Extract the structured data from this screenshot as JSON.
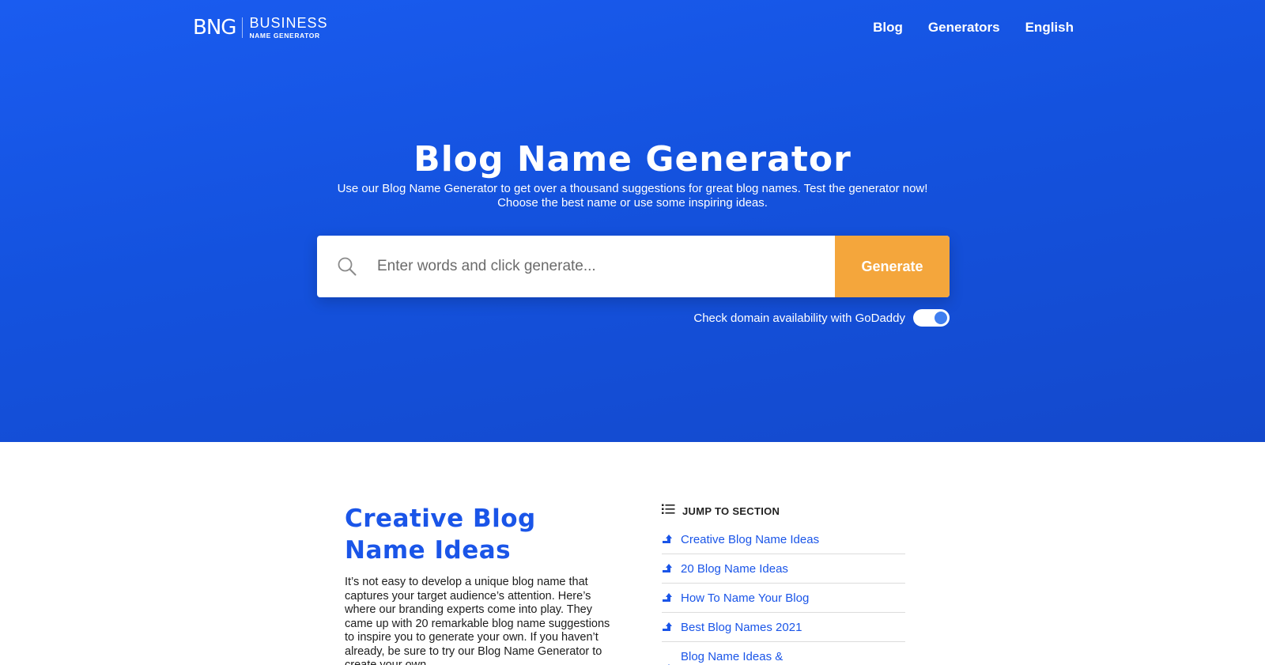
{
  "header": {
    "logo_mark": "BNG",
    "logo_line1": "BUSINESS",
    "logo_line2": "NAME GENERATOR",
    "nav": [
      {
        "label": "Blog"
      },
      {
        "label": "Generators"
      },
      {
        "label": "English"
      }
    ]
  },
  "hero": {
    "title": "Blog Name Generator",
    "subtitle_line1": "Use our Blog Name Generator to get over a thousand suggestions for great blog names. Test the generator now!",
    "subtitle_line2": "Choose the best name or use some inspiring ideas.",
    "search": {
      "placeholder": "Enter words and click generate...",
      "value": "",
      "button_label": "Generate"
    },
    "domain_check": {
      "label": "Check domain availability with GoDaddy",
      "enabled": true
    }
  },
  "content": {
    "section_title_line1": "Creative Blog",
    "section_title_line2": "Name Ideas",
    "body": "It’s not easy to develop a unique blog name that captures your target audience’s attention. Here’s where our branding experts come into play. They came up with 20 remarkable blog name suggestions to inspire you to generate your own. If you haven’t already, be sure to try our Blog Name Generator to create your own"
  },
  "toc": {
    "heading": "JUMP TO SECTION",
    "items": [
      {
        "label": "Creative Blog Name Ideas"
      },
      {
        "label": "20 Blog Name Ideas"
      },
      {
        "label": "How To Name Your Blog"
      },
      {
        "label": "Best Blog Names 2021"
      },
      {
        "label": "Blog Name Ideas &"
      }
    ]
  },
  "colors": {
    "hero_blue": "#1552e0",
    "accent_orange": "#f4a63c",
    "link_blue": "#1a55e8"
  }
}
